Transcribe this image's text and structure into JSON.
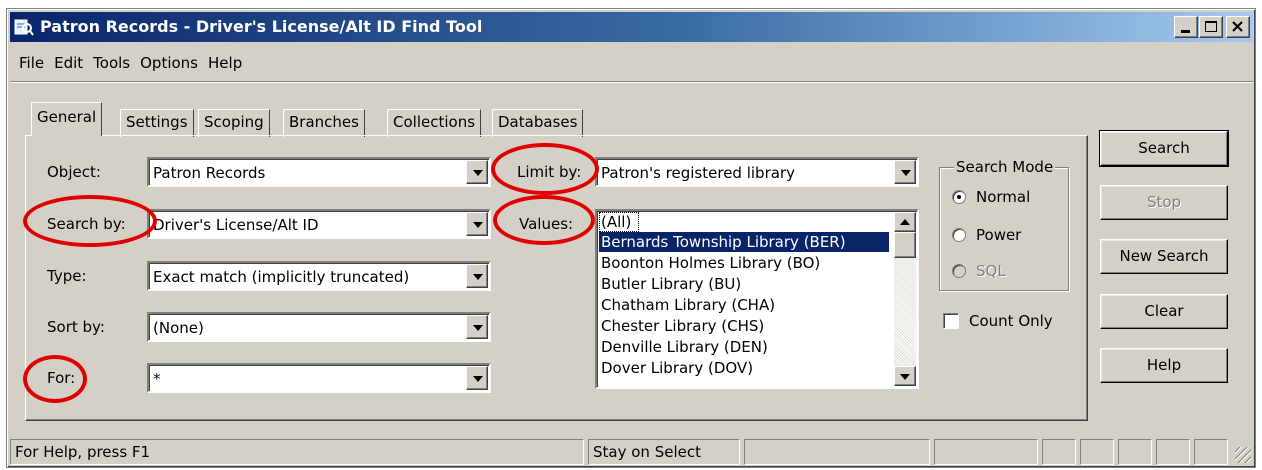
{
  "window": {
    "title": "Patron Records - Driver's License/Alt ID Find Tool"
  },
  "menu": [
    "File",
    "Edit",
    "Tools",
    "Options",
    "Help"
  ],
  "tabs": [
    "General",
    "Settings",
    "Scoping",
    "Branches",
    "Collections",
    "Databases"
  ],
  "active_tab": "General",
  "form": {
    "object_label": "Object:",
    "object_value": "Patron Records",
    "search_by_label": "Search by:",
    "search_by_value": "Driver's License/Alt ID",
    "type_label": "Type:",
    "type_value": "Exact match (implicitly truncated)",
    "sort_by_label": "Sort by:",
    "sort_by_value": "(None)",
    "for_label": "For:",
    "for_value": "*",
    "limit_by_label": "Limit by:",
    "limit_by_value": "Patron's registered library",
    "values_label": "Values:"
  },
  "values_list": [
    "(All)",
    "Bernards Township Library (BER)",
    "Boonton Holmes Library (BO)",
    "Butler Library (BU)",
    "Chatham Library (CHA)",
    "Chester Library (CHS)",
    "Denville Library (DEN)",
    "Dover Library (DOV)"
  ],
  "selected_value": "Bernards Township Library (BER)",
  "search_mode": {
    "title": "Search Mode",
    "options": [
      "Normal",
      "Power",
      "SQL"
    ],
    "selected": "Normal"
  },
  "count_only_label": "Count Only",
  "count_only_checked": false,
  "buttons": {
    "search": "Search",
    "stop": "Stop",
    "new_search": "New Search",
    "clear": "Clear",
    "help": "Help"
  },
  "status": {
    "help_text": "For Help, press F1",
    "select_mode": "Stay on Select"
  },
  "colors": {
    "annotation_circle": "#e00000",
    "selection": "#0a246a",
    "face": "#d4d0c8"
  }
}
